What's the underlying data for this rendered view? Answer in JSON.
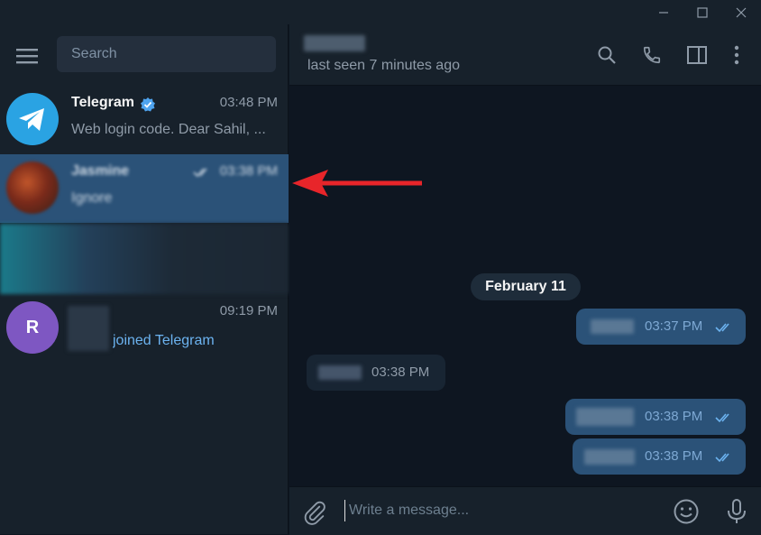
{
  "window": {
    "minimize_label": "—",
    "maximize_label": "☐",
    "close_label": "✕"
  },
  "sidebar": {
    "search_placeholder": "Search",
    "chats": [
      {
        "name": "Telegram",
        "time": "03:48 PM",
        "preview": "Web login code. Dear Sahil, ..."
      },
      {
        "name": "Jasmine",
        "time": "03:38 PM",
        "preview": "Ignore"
      },
      {
        "name": "",
        "time": "",
        "preview": ""
      },
      {
        "name": "",
        "time": "09:19 PM",
        "preview": "joined Telegram",
        "avatar_letter": "R"
      }
    ]
  },
  "conversation": {
    "status": "last seen 7 minutes ago",
    "date_separator": "February 11",
    "messages": [
      {
        "direction": "out",
        "time": "03:37 PM"
      },
      {
        "direction": "in",
        "time": "03:38 PM"
      },
      {
        "direction": "out",
        "time": "03:38 PM"
      },
      {
        "direction": "out",
        "time": "03:38 PM"
      }
    ],
    "composer_placeholder": "Write a message..."
  },
  "colors": {
    "accent": "#2b5278",
    "telegram_blue": "#2aa3e3",
    "avatar_purple": "#7e57c2",
    "arrow_red": "#e8252a"
  }
}
